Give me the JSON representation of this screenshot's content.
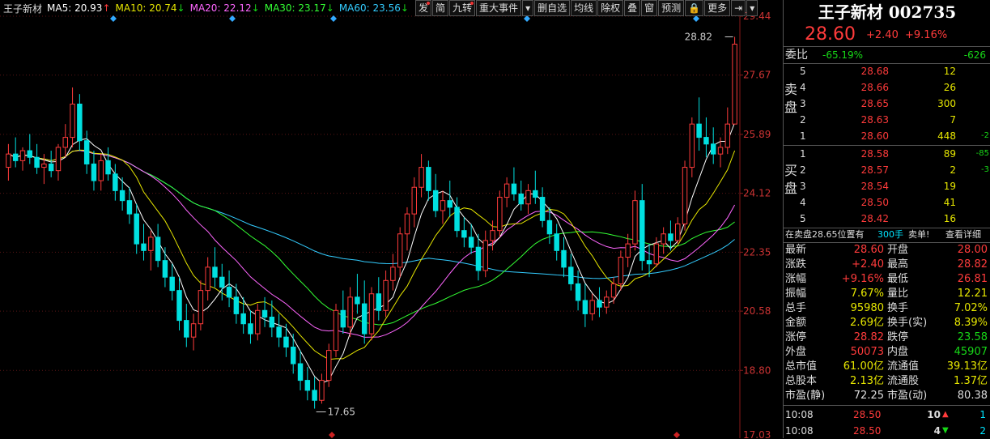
{
  "stock_name": "王子新材",
  "ma_legend": [
    {
      "label": "MA5: 20.93",
      "arrow": "↑",
      "color": "#ffffff",
      "arrow_color": "#ff3b3b"
    },
    {
      "label": "MA10: 20.74",
      "arrow": "↓",
      "color": "#e6e600",
      "arrow_color": "#17d817"
    },
    {
      "label": "MA20: 22.12",
      "arrow": "↓",
      "color": "#ff66ff",
      "arrow_color": "#17d817"
    },
    {
      "label": "MA30: 23.17",
      "arrow": "↓",
      "color": "#33ff33",
      "arrow_color": "#17d817"
    },
    {
      "label": "MA60: 23.56",
      "arrow": "↓",
      "color": "#33ccff",
      "arrow_color": "#17d817"
    }
  ],
  "toolbar": [
    "发",
    "简",
    "九转",
    "重大事件",
    "▾",
    "删自选",
    "均线",
    "除权",
    "叠",
    "窗",
    "预测",
    "🔒",
    "更多",
    "⇥",
    "▾"
  ],
  "chart_data": {
    "type": "candlestick",
    "y_ticks": [
      29.44,
      27.67,
      25.89,
      24.12,
      22.35,
      20.58,
      18.8
    ],
    "ylim": [
      17.03,
      29.44
    ],
    "high_marker": "28.82",
    "low_marker": "17.65",
    "bottom_tick": "17.03",
    "colors": {
      "up": "#ff3b3b",
      "down": "#00e0e0",
      "ma5": "#ffffff",
      "ma10": "#e6e600",
      "ma20": "#ff66ff",
      "ma30": "#33ff33",
      "ma60": "#33ccff"
    },
    "candles": [
      [
        24.9,
        25.6,
        24.5,
        25.3
      ],
      [
        25.3,
        25.8,
        24.9,
        25.1
      ],
      [
        25.1,
        25.5,
        24.8,
        25.4
      ],
      [
        25.4,
        25.9,
        25.0,
        25.2
      ],
      [
        25.2,
        25.6,
        24.7,
        24.9
      ],
      [
        24.9,
        25.3,
        24.4,
        25.0
      ],
      [
        25.0,
        25.4,
        24.6,
        24.8
      ],
      [
        24.8,
        25.6,
        24.5,
        25.5
      ],
      [
        25.5,
        26.2,
        25.2,
        25.8
      ],
      [
        25.8,
        27.3,
        25.5,
        26.8
      ],
      [
        26.8,
        27.1,
        25.4,
        25.7
      ],
      [
        25.7,
        26.0,
        24.7,
        25.0
      ],
      [
        25.0,
        25.4,
        24.2,
        24.5
      ],
      [
        24.5,
        25.3,
        24.2,
        25.1
      ],
      [
        25.1,
        25.5,
        24.5,
        24.7
      ],
      [
        24.7,
        25.0,
        23.9,
        24.2
      ],
      [
        24.2,
        24.6,
        23.6,
        23.9
      ],
      [
        23.9,
        24.3,
        23.2,
        23.5
      ],
      [
        23.5,
        23.8,
        22.3,
        22.6
      ],
      [
        22.6,
        23.2,
        22.1,
        22.4
      ],
      [
        22.4,
        23.0,
        21.8,
        22.8
      ],
      [
        22.8,
        23.2,
        21.9,
        22.1
      ],
      [
        22.1,
        22.5,
        21.3,
        21.6
      ],
      [
        21.6,
        22.0,
        20.9,
        21.2
      ],
      [
        21.2,
        21.6,
        20.0,
        20.3
      ],
      [
        20.3,
        20.8,
        19.5,
        19.8
      ],
      [
        19.8,
        20.5,
        19.4,
        20.2
      ],
      [
        20.2,
        21.5,
        20.0,
        21.2
      ],
      [
        21.2,
        22.2,
        20.9,
        21.9
      ],
      [
        21.9,
        22.5,
        21.3,
        21.6
      ],
      [
        21.6,
        22.0,
        20.9,
        21.3
      ],
      [
        21.3,
        21.8,
        20.7,
        21.0
      ],
      [
        21.0,
        21.4,
        20.2,
        20.5
      ],
      [
        20.5,
        21.0,
        19.9,
        20.2
      ],
      [
        20.2,
        20.6,
        19.6,
        19.9
      ],
      [
        19.9,
        20.8,
        19.7,
        20.6
      ],
      [
        20.6,
        21.0,
        20.1,
        20.4
      ],
      [
        20.4,
        20.9,
        19.8,
        20.1
      ],
      [
        20.1,
        20.5,
        19.5,
        19.8
      ],
      [
        19.8,
        20.2,
        19.2,
        19.5
      ],
      [
        19.5,
        19.9,
        18.7,
        19.0
      ],
      [
        19.0,
        19.4,
        18.2,
        18.5
      ],
      [
        18.5,
        18.9,
        17.9,
        18.2
      ],
      [
        18.2,
        18.6,
        17.65,
        17.9
      ],
      [
        17.9,
        18.7,
        17.8,
        18.5
      ],
      [
        18.5,
        19.6,
        18.3,
        19.4
      ],
      [
        19.4,
        20.8,
        19.2,
        20.6
      ],
      [
        20.6,
        21.2,
        19.9,
        20.1
      ],
      [
        20.1,
        21.3,
        19.8,
        21.0
      ],
      [
        21.0,
        21.7,
        20.5,
        20.8
      ],
      [
        20.8,
        21.5,
        19.6,
        19.9
      ],
      [
        19.9,
        21.3,
        19.7,
        21.1
      ],
      [
        21.1,
        21.6,
        20.3,
        20.6
      ],
      [
        20.6,
        21.8,
        20.4,
        21.5
      ],
      [
        21.5,
        22.3,
        21.2,
        21.9
      ],
      [
        21.9,
        23.1,
        21.6,
        22.9
      ],
      [
        22.9,
        23.7,
        22.4,
        23.5
      ],
      [
        23.5,
        24.6,
        23.1,
        24.3
      ],
      [
        24.3,
        25.3,
        24.0,
        24.9
      ],
      [
        24.9,
        25.1,
        23.9,
        24.2
      ],
      [
        24.2,
        24.7,
        23.4,
        23.6
      ],
      [
        23.6,
        24.2,
        23.2,
        23.9
      ],
      [
        23.9,
        24.5,
        23.4,
        23.7
      ],
      [
        23.7,
        24.0,
        22.8,
        23.0
      ],
      [
        23.0,
        23.4,
        22.5,
        22.8
      ],
      [
        22.8,
        23.2,
        22.3,
        22.5
      ],
      [
        22.5,
        22.9,
        21.5,
        21.8
      ],
      [
        21.8,
        23.0,
        21.6,
        22.7
      ],
      [
        22.7,
        23.3,
        22.4,
        23.0
      ],
      [
        23.0,
        24.2,
        22.8,
        24.0
      ],
      [
        24.0,
        24.6,
        23.7,
        24.4
      ],
      [
        24.4,
        24.9,
        23.9,
        24.1
      ],
      [
        24.1,
        24.5,
        23.6,
        23.8
      ],
      [
        23.8,
        24.4,
        23.5,
        24.2
      ],
      [
        24.2,
        24.8,
        23.8,
        24.0
      ],
      [
        24.0,
        24.3,
        23.1,
        23.3
      ],
      [
        23.3,
        23.7,
        22.6,
        22.9
      ],
      [
        22.9,
        23.2,
        22.1,
        22.4
      ],
      [
        22.4,
        22.8,
        21.6,
        21.9
      ],
      [
        21.9,
        22.3,
        21.2,
        21.4
      ],
      [
        21.4,
        21.8,
        20.6,
        20.9
      ],
      [
        20.9,
        21.4,
        20.1,
        20.5
      ],
      [
        20.5,
        21.1,
        20.3,
        20.9
      ],
      [
        20.9,
        21.3,
        20.4,
        20.7
      ],
      [
        20.7,
        21.2,
        20.5,
        21.0
      ],
      [
        21.0,
        21.6,
        20.8,
        21.4
      ],
      [
        21.4,
        22.4,
        21.2,
        22.2
      ],
      [
        22.2,
        22.9,
        21.9,
        22.6
      ],
      [
        22.6,
        24.2,
        22.4,
        23.9
      ],
      [
        23.9,
        24.4,
        21.8,
        22.1
      ],
      [
        22.1,
        22.6,
        21.6,
        22.0
      ],
      [
        22.0,
        22.8,
        21.9,
        22.6
      ],
      [
        22.6,
        23.1,
        22.3,
        22.9
      ],
      [
        22.9,
        23.3,
        22.4,
        22.7
      ],
      [
        22.7,
        23.4,
        22.6,
        23.2
      ],
      [
        23.2,
        25.1,
        23.0,
        24.9
      ],
      [
        24.9,
        26.4,
        24.6,
        26.2
      ],
      [
        26.2,
        27.0,
        25.4,
        25.8
      ],
      [
        25.8,
        26.4,
        25.2,
        25.6
      ],
      [
        25.6,
        26.1,
        25.0,
        25.3
      ],
      [
        25.3,
        25.8,
        24.9,
        25.5
      ],
      [
        25.5,
        26.7,
        25.3,
        26.2
      ],
      [
        26.2,
        28.82,
        26.2,
        28.6
      ]
    ]
  },
  "panel": {
    "title": "王子新材 002735",
    "price": "28.60",
    "change": "+2.40",
    "change_pct": "+9.16%",
    "weibi_label": "委比",
    "weibi_pct": "-65.19%",
    "weibi_diff": "-626",
    "sell_label": "卖盘",
    "buy_label": "买盘",
    "asks": [
      {
        "level": "5",
        "price": "28.68",
        "vol": "12",
        "diff": ""
      },
      {
        "level": "4",
        "price": "28.66",
        "vol": "26",
        "diff": ""
      },
      {
        "level": "3",
        "price": "28.65",
        "vol": "300",
        "diff": ""
      },
      {
        "level": "2",
        "price": "28.63",
        "vol": "7",
        "diff": ""
      },
      {
        "level": "1",
        "price": "28.60",
        "vol": "448",
        "diff": "-2"
      }
    ],
    "bids": [
      {
        "level": "1",
        "price": "28.58",
        "vol": "89",
        "diff": "-85"
      },
      {
        "level": "2",
        "price": "28.57",
        "vol": "2",
        "diff": "-3"
      },
      {
        "level": "3",
        "price": "28.54",
        "vol": "19",
        "diff": ""
      },
      {
        "level": "4",
        "price": "28.50",
        "vol": "41",
        "diff": ""
      },
      {
        "level": "5",
        "price": "28.42",
        "vol": "16",
        "diff": ""
      }
    ],
    "notice_text": "在卖盘28.65位置有",
    "notice_vol": "300手",
    "notice_tag": "卖单!",
    "detail_link": "查看详细",
    "stats": [
      {
        "l1": "最新",
        "v1": "28.60",
        "c1": "red",
        "l2": "开盘",
        "v2": "28.00",
        "c2": "red"
      },
      {
        "l1": "涨跌",
        "v1": "+2.40",
        "c1": "red",
        "l2": "最高",
        "v2": "28.82",
        "c2": "red"
      },
      {
        "l1": "涨幅",
        "v1": "+9.16%",
        "c1": "red",
        "l2": "最低",
        "v2": "26.81",
        "c2": "red"
      },
      {
        "l1": "振幅",
        "v1": "7.67%",
        "c1": "yellow",
        "l2": "量比",
        "v2": "12.21",
        "c2": "yellow"
      },
      {
        "l1": "总手",
        "v1": "95980",
        "c1": "yellow",
        "l2": "换手",
        "v2": "7.02%",
        "c2": "yellow"
      },
      {
        "l1": "金额",
        "v1": "2.69亿",
        "c1": "yellow",
        "l2": "换手(实)",
        "v2": "8.39%",
        "c2": "yellow"
      },
      {
        "l1": "涨停",
        "v1": "28.82",
        "c1": "red",
        "l2": "跌停",
        "v2": "23.58",
        "c2": "green"
      },
      {
        "l1": "外盘",
        "v1": "50073",
        "c1": "red",
        "l2": "内盘",
        "v2": "45907",
        "c2": "green"
      },
      {
        "l1": "总市值",
        "v1": "61.00亿",
        "c1": "yellow",
        "l2": "流通值",
        "v2": "39.13亿",
        "c2": "yellow"
      },
      {
        "l1": "总股本",
        "v1": "2.13亿",
        "c1": "yellow",
        "l2": "流通股",
        "v2": "1.37亿",
        "c2": "yellow"
      },
      {
        "l1": "市盈(静)",
        "v1": "72.25",
        "c1": "white",
        "l2": "市盈(动)",
        "v2": "80.38",
        "c2": "white"
      }
    ],
    "ticks": [
      {
        "time": "10:08",
        "price": "28.50",
        "vol": "10",
        "dir": "up",
        "n": "1"
      },
      {
        "time": "10:08",
        "price": "28.50",
        "vol": "4",
        "dir": "down",
        "n": "2"
      }
    ]
  }
}
